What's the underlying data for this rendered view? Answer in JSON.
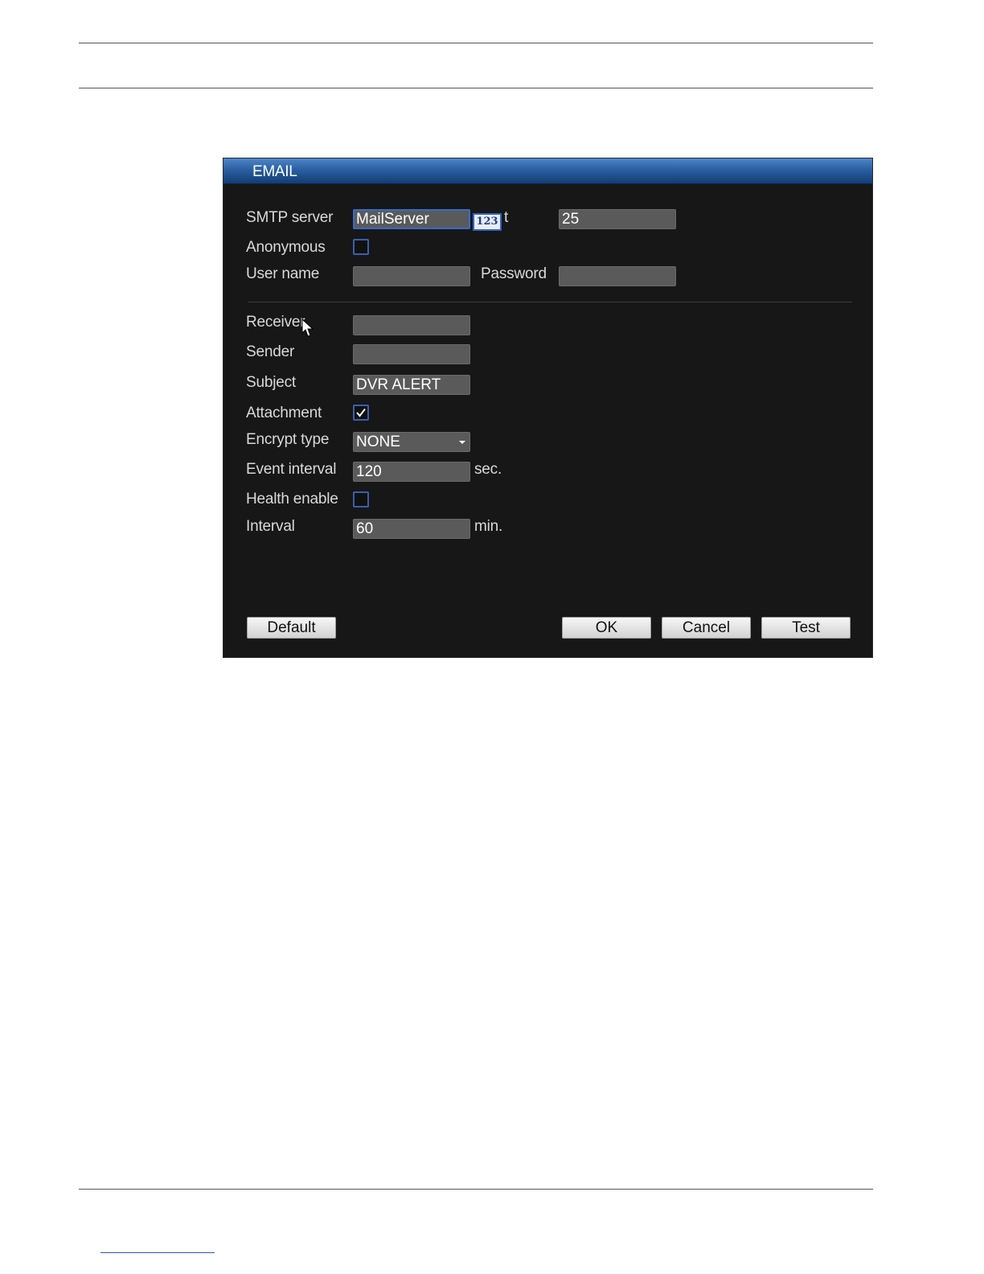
{
  "dialog": {
    "title": "EMAIL",
    "smtp_server": {
      "label": "SMTP server",
      "value": "MailServer"
    },
    "ime_badge": "123",
    "port": {
      "label_fragment": "t",
      "value": "25"
    },
    "anonymous": {
      "label": "Anonymous",
      "checked": false
    },
    "user_name": {
      "label": "User name",
      "value": ""
    },
    "password": {
      "label": "Password",
      "value": ""
    },
    "receiver": {
      "label": "Receiver",
      "value": ""
    },
    "sender": {
      "label": "Sender",
      "value": ""
    },
    "subject": {
      "label": "Subject",
      "value": "DVR ALERT"
    },
    "attachment": {
      "label": "Attachment",
      "checked": true
    },
    "encrypt_type": {
      "label": "Encrypt type",
      "value": "NONE"
    },
    "event_interval": {
      "label": "Event interval",
      "value": "120",
      "unit": "sec."
    },
    "health_enable": {
      "label": "Health enable",
      "checked": false
    },
    "interval": {
      "label": "Interval",
      "value": "60",
      "unit": "min."
    },
    "buttons": {
      "default": "Default",
      "ok": "OK",
      "cancel": "Cancel",
      "test": "Test"
    }
  },
  "colors": {
    "titlebar": "#2a5fa1",
    "dialog_bg": "#171717",
    "field_bg": "#5a5a5a",
    "checkbox_border": "#3a5fae"
  }
}
